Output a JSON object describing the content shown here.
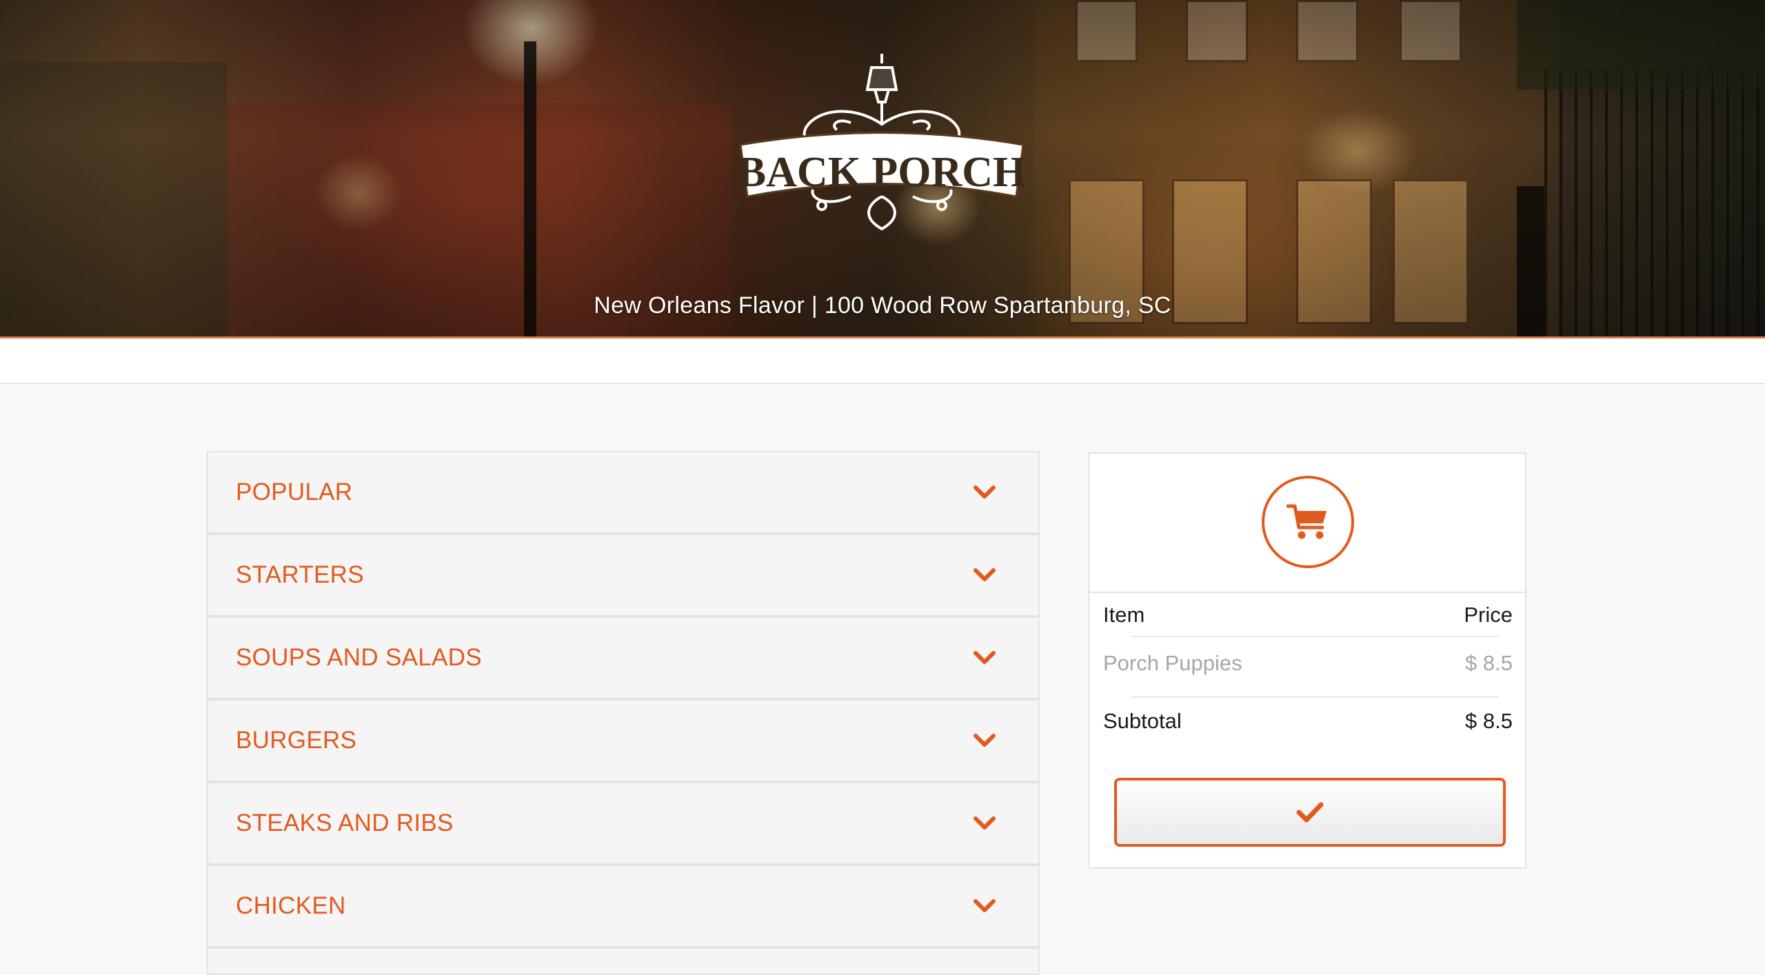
{
  "header": {
    "logo_text": "BACK PORCH",
    "tagline": "New Orleans Flavor | 100 Wood Row Spartanburg, SC"
  },
  "menu": {
    "categories": [
      {
        "label": "POPULAR"
      },
      {
        "label": "STARTERS"
      },
      {
        "label": "SOUPS AND SALADS"
      },
      {
        "label": "BURGERS"
      },
      {
        "label": "STEAKS AND RIBS"
      },
      {
        "label": "CHICKEN"
      }
    ]
  },
  "cart": {
    "icon": "shopping-cart-icon",
    "headers": {
      "item": "Item",
      "price": "Price"
    },
    "items": [
      {
        "name": "Porch Puppies",
        "price": "$ 8.5"
      }
    ],
    "subtotal_label": "Subtotal",
    "subtotal_value": "$ 8.5",
    "checkout_icon": "checkmark-icon"
  },
  "colors": {
    "accent": "#e35a1f",
    "panel_bg": "#f5f5f5",
    "page_bg": "#f8f8f8"
  }
}
